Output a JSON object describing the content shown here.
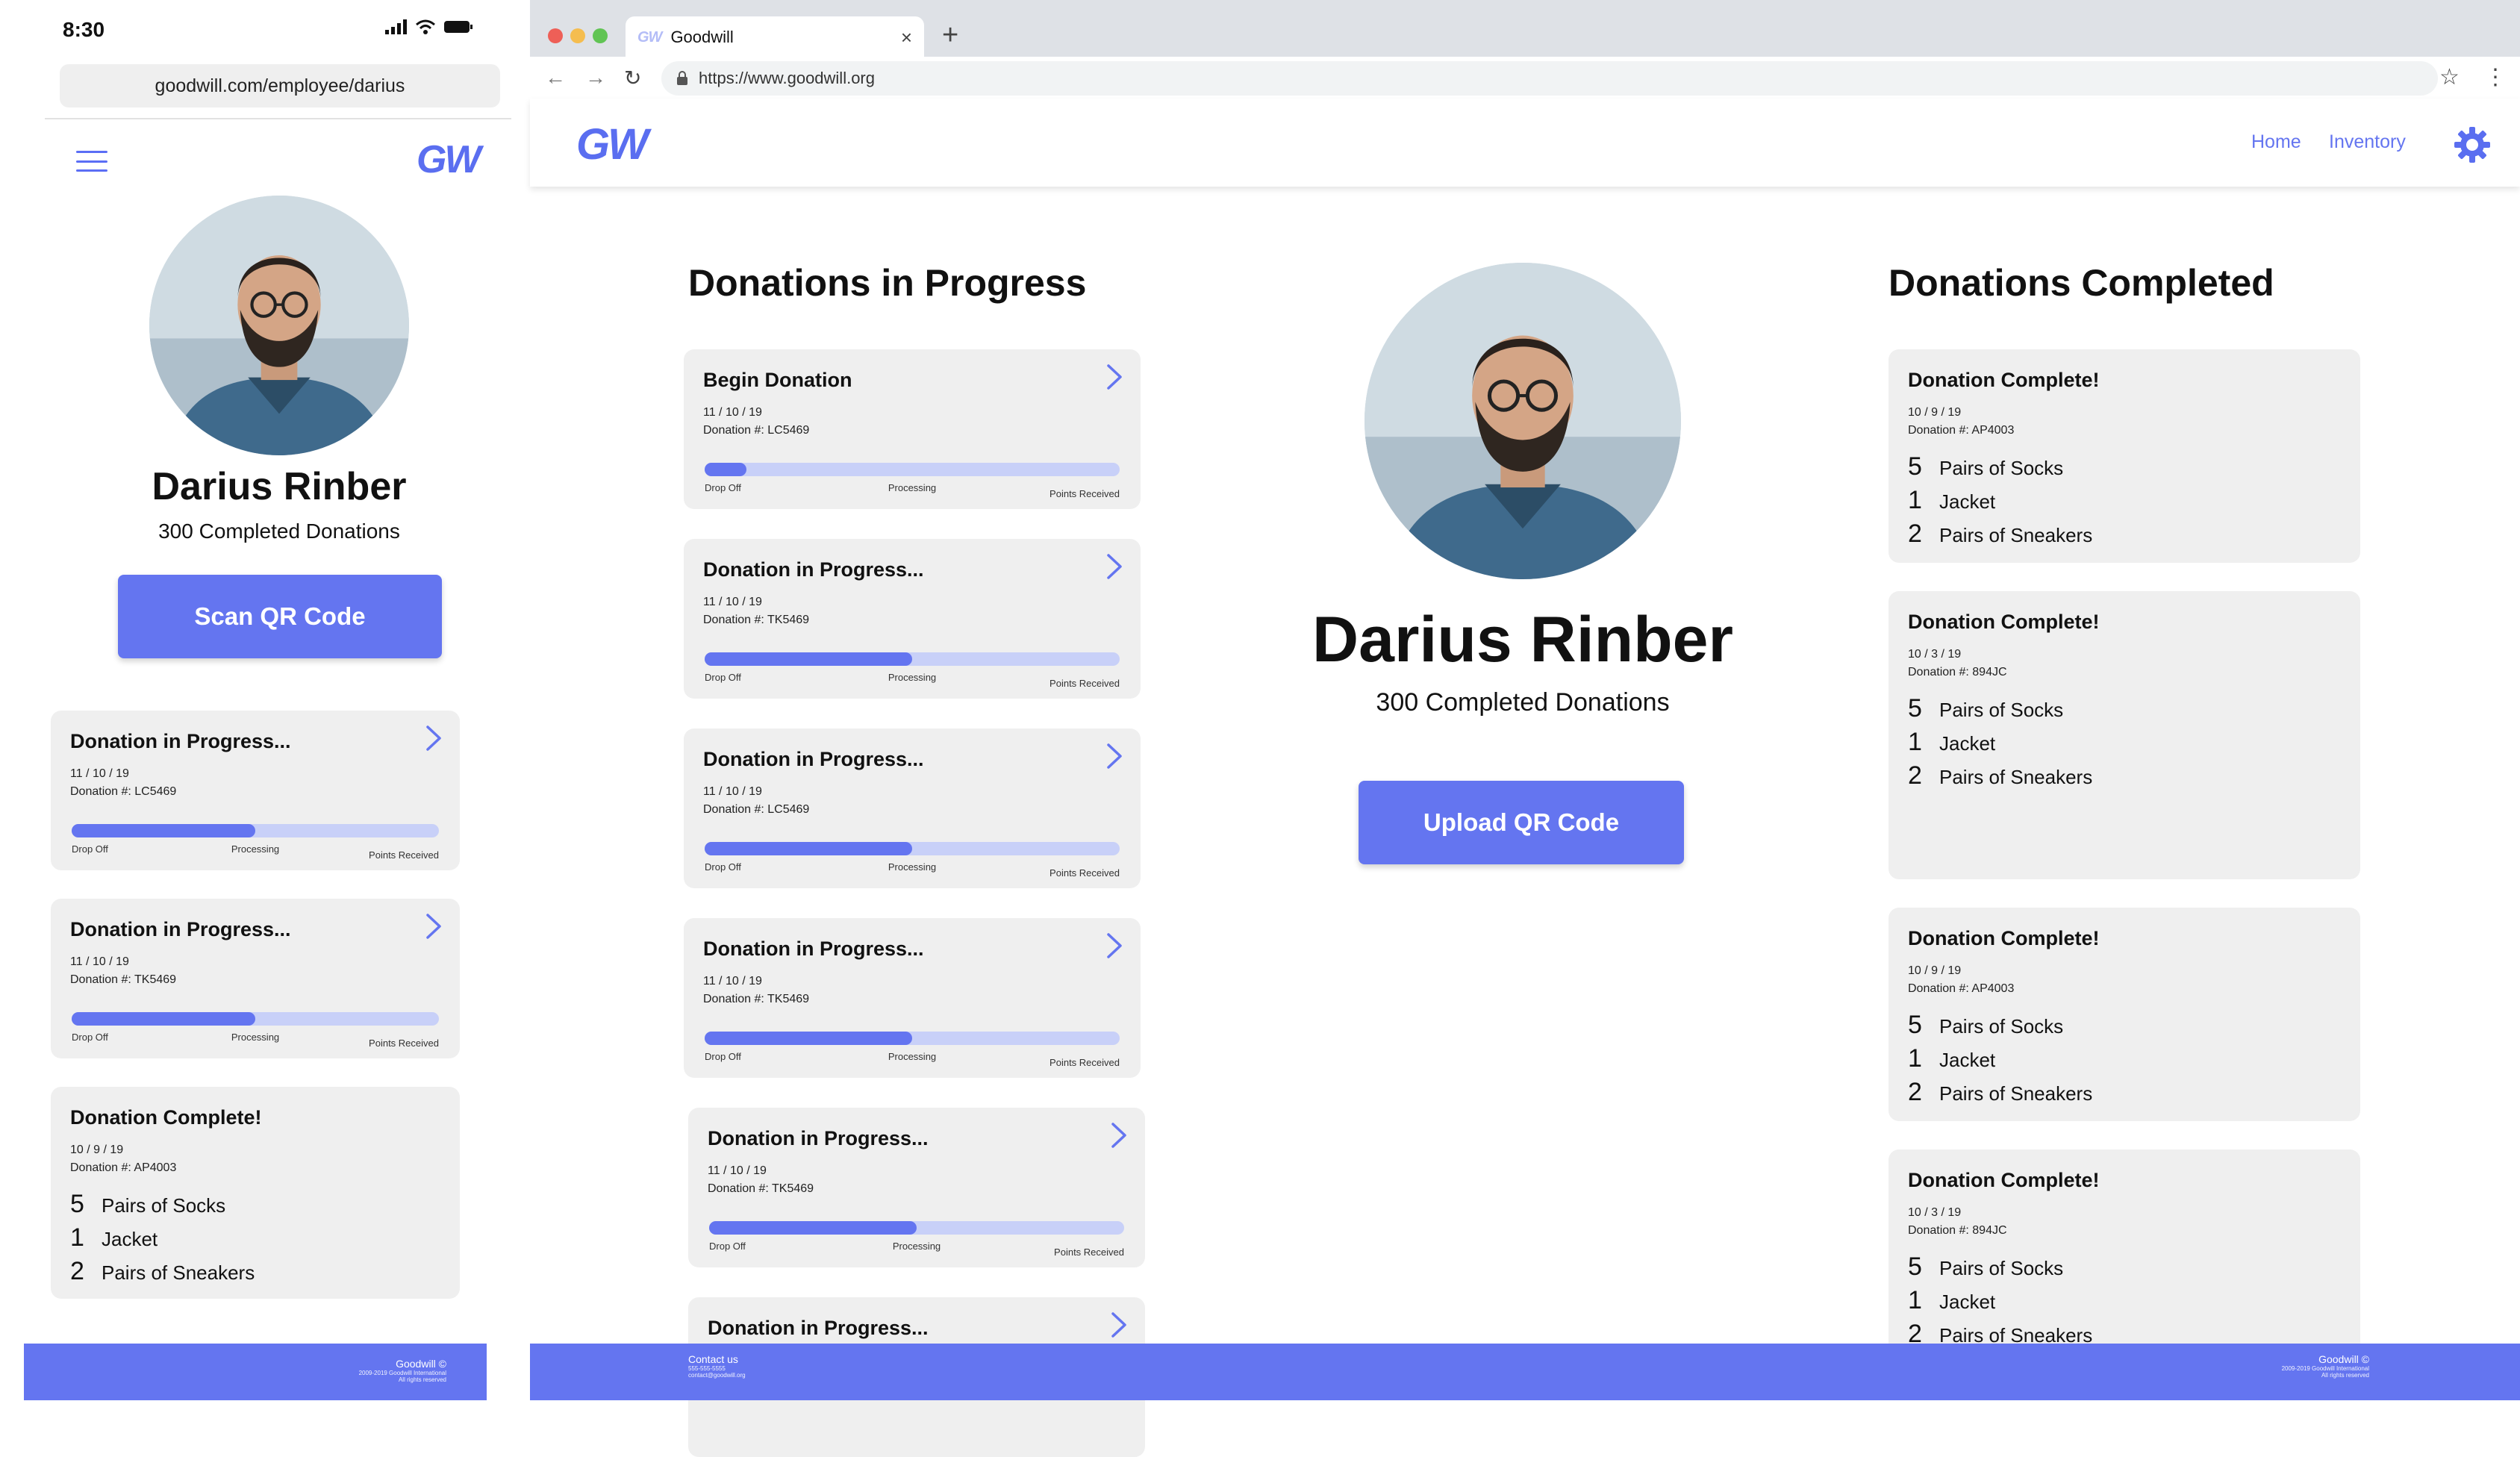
{
  "colors": {
    "accent": "#6475f0",
    "accent_light": "#c8d0f8",
    "card_bg": "#efefef"
  },
  "phone": {
    "status_time": "8:30",
    "url": "goodwill.com/employee/darius",
    "logo": "GW",
    "name": "Darius Rinber",
    "completed": "300 Completed Donations",
    "button_label": "Scan QR Code",
    "progress_labels": [
      "Drop Off",
      "Processing",
      "Points Received"
    ],
    "in_progress": [
      {
        "title": "Donation in Progress...",
        "date": "11 / 10 / 19",
        "number": "Donation #: LC5469",
        "progress": 0.5
      },
      {
        "title": "Donation in Progress...",
        "date": "11 / 10 / 19",
        "number": "Donation #: TK5469",
        "progress": 0.5
      }
    ],
    "completed_card": {
      "title": "Donation Complete!",
      "date": "10 / 9 / 19",
      "number": "Donation #: AP4003",
      "items": [
        {
          "qty": "5",
          "name": "Pairs of Socks"
        },
        {
          "qty": "1",
          "name": "Jacket"
        },
        {
          "qty": "2",
          "name": "Pairs of Sneakers"
        }
      ]
    },
    "footer": {
      "brand": "Goodwill ©",
      "line1": "2009-2019 Goodwill International",
      "line2": "All rights reserved"
    }
  },
  "browser": {
    "tab_title": "Goodwill",
    "url": "https://www.goodwill.org",
    "logo": "GW",
    "nav": {
      "home": "Home",
      "inventory": "Inventory"
    },
    "in_progress_title": "Donations in Progress",
    "completed_title": "Donations Completed",
    "name": "Darius Rinber",
    "completed": "300 Completed Donations",
    "button_label": "Upload QR Code",
    "progress_labels": [
      "Drop Off",
      "Processing",
      "Points Received"
    ],
    "in_progress": [
      {
        "title": "Begin Donation",
        "date": "11 / 10 / 19",
        "number": "Donation #: LC5469",
        "progress": 0.1
      },
      {
        "title": "Donation in Progress...",
        "date": "11 / 10 / 19",
        "number": "Donation #: TK5469",
        "progress": 0.5
      },
      {
        "title": "Donation in Progress...",
        "date": "11 / 10 / 19",
        "number": "Donation #: LC5469",
        "progress": 0.5
      },
      {
        "title": "Donation in Progress...",
        "date": "11 / 10 / 19",
        "number": "Donation #: TK5469",
        "progress": 0.5
      },
      {
        "title": "Donation in Progress...",
        "date": "11 / 10 / 19",
        "number": "Donation #: TK5469",
        "progress": 0.5
      },
      {
        "title": "Donation in Progress..."
      }
    ],
    "completed_cards": [
      {
        "title": "Donation Complete!",
        "date": "10 / 9 / 19",
        "number": "Donation #: AP4003",
        "items": [
          {
            "qty": "5",
            "name": "Pairs of Socks"
          },
          {
            "qty": "1",
            "name": "Jacket"
          },
          {
            "qty": "2",
            "name": "Pairs of Sneakers"
          }
        ]
      },
      {
        "title": "Donation Complete!",
        "date": "10 / 3 / 19",
        "number": "Donation #: 894JC",
        "items": [
          {
            "qty": "5",
            "name": "Pairs of Socks"
          },
          {
            "qty": "1",
            "name": "Jacket"
          },
          {
            "qty": "2",
            "name": "Pairs of Sneakers"
          }
        ]
      },
      {
        "title": "Donation Complete!",
        "date": "10 / 9 / 19",
        "number": "Donation #: AP4003",
        "items": [
          {
            "qty": "5",
            "name": "Pairs of Socks"
          },
          {
            "qty": "1",
            "name": "Jacket"
          },
          {
            "qty": "2",
            "name": "Pairs of Sneakers"
          }
        ]
      },
      {
        "title": "Donation Complete!",
        "date": "10 / 3 / 19",
        "number": "Donation #: 894JC",
        "items": [
          {
            "qty": "5",
            "name": "Pairs of Socks"
          },
          {
            "qty": "1",
            "name": "Jacket"
          },
          {
            "qty": "2",
            "name": "Pairs of Sneakers"
          }
        ]
      }
    ],
    "footer": {
      "contact": "Contact us",
      "phone": "555-555-5555",
      "email": "contact@goodwill.org",
      "brand": "Goodwill ©",
      "line1": "2009-2019 Goodwill International",
      "line2": "All rights reserved"
    }
  }
}
